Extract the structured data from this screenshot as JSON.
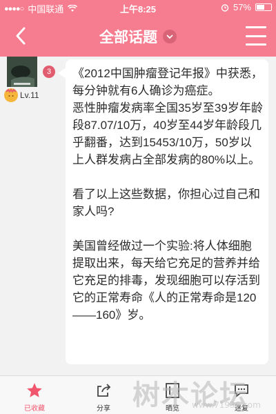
{
  "status_bar": {
    "signal": "●●●●○",
    "carrier": "中国联通",
    "time": "上午8:25",
    "battery": "57%",
    "battery_level": 0.57
  },
  "nav": {
    "title": "全部话题"
  },
  "post": {
    "level": "Lv.11",
    "comment_badge": "3",
    "content": "《2012中国肿瘤登记年报》中获悉，每分钟就有6人确诊为癌症。\n恶性肿瘤发病率全国35岁至39岁年龄段87.07/10万，40岁至44岁年龄段几乎翻番，达到15453/10万，50岁以上人群发病占全部发病的80%以上。\n\n看了以上这些数据，你担心过自己和家人吗?\n\n美国曾经做过一个实验:将人体细胞提取出来，每天给它充足的营养并给它充足的排毒，发现细胞可以存活到它的正常寿命《人的正常寿命是120——160》岁。"
  },
  "tabs": [
    {
      "label": "已收藏",
      "icon": "star-icon",
      "active": true
    },
    {
      "label": "分享",
      "icon": "share-icon"
    },
    {
      "label": "晒览",
      "icon": "view-icon"
    },
    {
      "label": "迷复",
      "icon": "reply-icon"
    }
  ],
  "watermark": {
    "text": "树木论坛",
    "url": "www.71936.com"
  },
  "colors": {
    "accent": "#f67c8f",
    "badge": "#e25c70",
    "star": "#f2566e"
  }
}
